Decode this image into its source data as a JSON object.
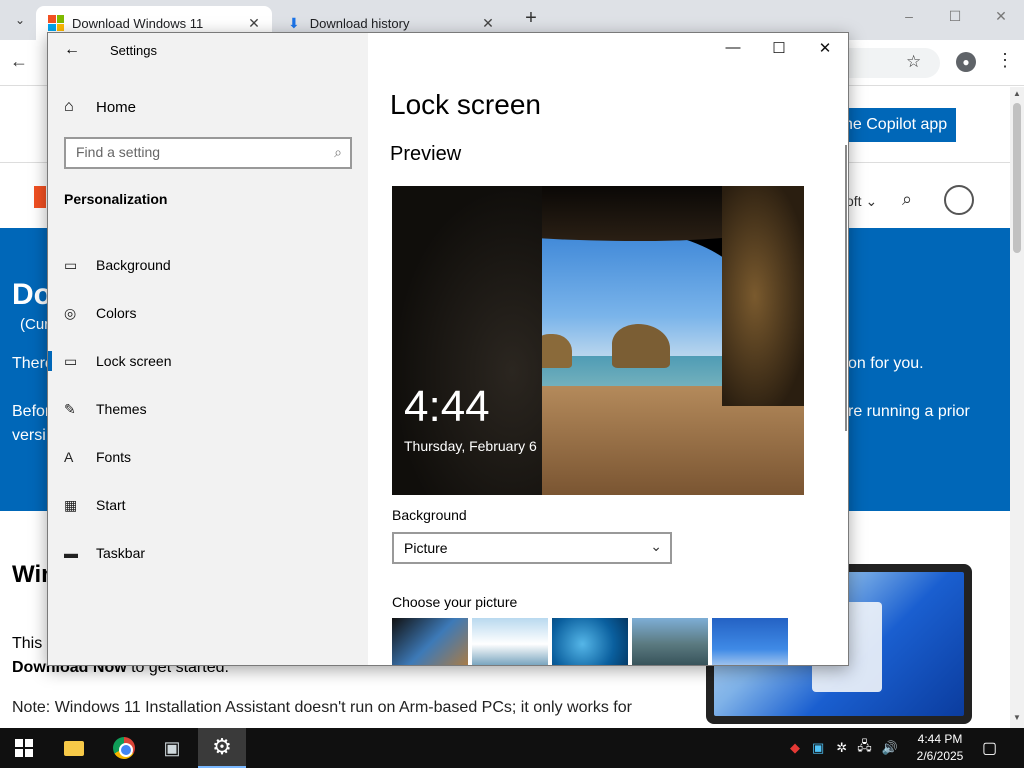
{
  "browser": {
    "tabs": [
      {
        "title": "Download Windows 11",
        "active": true,
        "icon": "windows-logo-icon"
      },
      {
        "title": "Download history",
        "active": false,
        "icon": "download-icon"
      }
    ],
    "new_tab_label": "+",
    "window_controls": {
      "minimize": "–",
      "maximize": "☐",
      "close": "✕"
    },
    "toolbar": {
      "back": "←",
      "star": "☆",
      "menu": "⋮"
    }
  },
  "webpage": {
    "copilot_button": "he Copilot app",
    "nav_menu_text": "oft ⌄",
    "hero_heading": "Do",
    "hero_sub": "(Cur",
    "hero_p1_left": "There",
    "hero_p1_right": "on for you.",
    "hero_p2_left": "Befor",
    "hero_p2_left2": "versi",
    "hero_p2_right": "re running a prior",
    "section_heading": "Win",
    "body_line1": "This i",
    "body_line2_bold": "Download Now",
    "body_line2_rest": " to get started.",
    "body_note": "Note: Windows 11 Installation Assistant doesn't run on Arm-based PCs; it only works for"
  },
  "settings": {
    "title": "Settings",
    "window_controls": {
      "minimize": "—",
      "maximize": "☐",
      "close": "✕"
    },
    "home_label": "Home",
    "search_placeholder": "Find a setting",
    "section": "Personalization",
    "nav": [
      {
        "label": "Background",
        "icon": "picture-icon",
        "active": false
      },
      {
        "label": "Colors",
        "icon": "palette-icon",
        "active": false
      },
      {
        "label": "Lock screen",
        "icon": "lock-screen-icon",
        "active": true
      },
      {
        "label": "Themes",
        "icon": "themes-icon",
        "active": false
      },
      {
        "label": "Fonts",
        "icon": "fonts-icon",
        "active": false
      },
      {
        "label": "Start",
        "icon": "start-icon",
        "active": false
      },
      {
        "label": "Taskbar",
        "icon": "taskbar-icon",
        "active": false
      }
    ],
    "page_title": "Lock screen",
    "preview_heading": "Preview",
    "preview_time": "4:44",
    "preview_date": "Thursday, February 6",
    "background_label": "Background",
    "background_value": "Picture",
    "choose_picture_label": "Choose your picture"
  },
  "taskbar": {
    "clock_time": "4:44 PM",
    "clock_date": "2/6/2025"
  },
  "colors": {
    "accent": "#0067b8",
    "taskbar": "#101010",
    "settings_sidebar": "#f2f2f2"
  }
}
